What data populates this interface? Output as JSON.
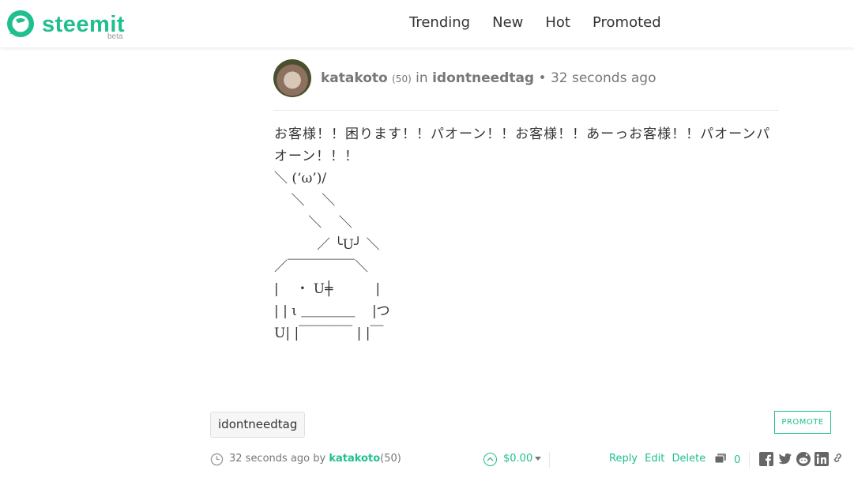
{
  "brand": {
    "name": "steemit",
    "badge": "beta",
    "color": "#1fbf8f"
  },
  "nav": {
    "items": [
      {
        "label": "Trending"
      },
      {
        "label": "New"
      },
      {
        "label": "Hot"
      },
      {
        "label": "Promoted"
      }
    ]
  },
  "post": {
    "author": "katakoto",
    "reputation": "(50)",
    "in_text": "in",
    "category": "idontneedtag",
    "bullet": "•",
    "time": "32 seconds ago",
    "body_first": "お客様！！困ります！！パオーン！！お客様！！あーっお客様！！パオーンパオーン！！！",
    "body_art": "＼ (‘ω’)/\n    ＼    ＼\n        ＼    ＼\n          ／ ╰U╯ ＼\n／￣￣￣￣￣＼\n|    ・ U╪          |\n| | ι ＿＿＿＿    |つ\nU| |￣￣￣￣ | |￣"
  },
  "tag": {
    "label": "idontneedtag"
  },
  "promote": {
    "label": "PROMOTE"
  },
  "footer": {
    "time": "32 seconds ago",
    "by": "by",
    "author": "katakoto",
    "reputation": "(50)",
    "payout": "$0.00",
    "reply": "Reply",
    "edit": "Edit",
    "delete": "Delete",
    "comment_count": "0",
    "share_icons": [
      "facebook-icon",
      "twitter-icon",
      "reddit-icon",
      "linkedin-icon",
      "link-icon"
    ]
  }
}
